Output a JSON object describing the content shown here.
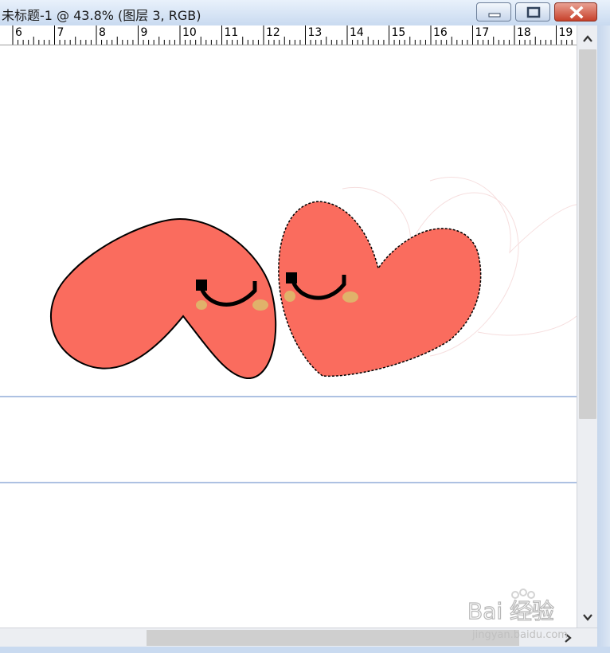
{
  "window": {
    "title": "未标题-1 @ 43.8% (图层 3, RGB)"
  },
  "ruler": {
    "ticks": [
      "6",
      "7",
      "8",
      "9",
      "10",
      "11",
      "12",
      "13",
      "14",
      "15",
      "16",
      "17",
      "18",
      "19"
    ]
  },
  "colors": {
    "heart_fill": "#fa6c5e",
    "cheek": "#e0b26a",
    "guide_line": "#5b83c4"
  },
  "icons": {
    "minimize": "minimize-icon",
    "maximize": "restore-icon",
    "close": "close-icon",
    "scroll_up": "chevron-up-icon",
    "scroll_down": "chevron-down-icon",
    "scroll_right": "chevron-right-icon"
  },
  "watermark": {
    "brand": "Bai 经验",
    "url": "jingyan.baidu.com"
  }
}
